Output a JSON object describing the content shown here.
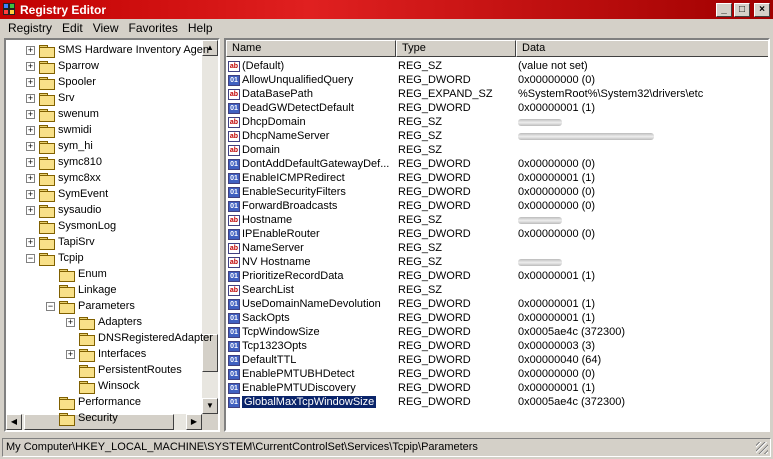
{
  "window": {
    "title": "Registry Editor"
  },
  "menu": [
    "Registry",
    "Edit",
    "View",
    "Favorites",
    "Help"
  ],
  "tree": [
    {
      "label": "SMS Hardware Inventory Agen",
      "exp": "+",
      "level": 1
    },
    {
      "label": "Sparrow",
      "exp": "+",
      "level": 1
    },
    {
      "label": "Spooler",
      "exp": "+",
      "level": 1
    },
    {
      "label": "Srv",
      "exp": "+",
      "level": 1
    },
    {
      "label": "swenum",
      "exp": "+",
      "level": 1
    },
    {
      "label": "swmidi",
      "exp": "+",
      "level": 1
    },
    {
      "label": "sym_hi",
      "exp": "+",
      "level": 1
    },
    {
      "label": "symc810",
      "exp": "+",
      "level": 1
    },
    {
      "label": "symc8xx",
      "exp": "+",
      "level": 1
    },
    {
      "label": "SymEvent",
      "exp": "+",
      "level": 1
    },
    {
      "label": "sysaudio",
      "exp": "+",
      "level": 1
    },
    {
      "label": "SysmonLog",
      "exp": "",
      "level": 1
    },
    {
      "label": "TapiSrv",
      "exp": "+",
      "level": 1
    },
    {
      "label": "Tcpip",
      "exp": "-",
      "level": 1
    },
    {
      "label": "Enum",
      "exp": "",
      "level": 2
    },
    {
      "label": "Linkage",
      "exp": "",
      "level": 2
    },
    {
      "label": "Parameters",
      "exp": "-",
      "level": 2
    },
    {
      "label": "Adapters",
      "exp": "+",
      "level": 3
    },
    {
      "label": "DNSRegisteredAdapter",
      "exp": "",
      "level": 3
    },
    {
      "label": "Interfaces",
      "exp": "+",
      "level": 3
    },
    {
      "label": "PersistentRoutes",
      "exp": "",
      "level": 3
    },
    {
      "label": "Winsock",
      "exp": "",
      "level": 3
    },
    {
      "label": "Performance",
      "exp": "",
      "level": 2
    },
    {
      "label": "Security",
      "exp": "",
      "level": 2
    }
  ],
  "columns": {
    "name": "Name",
    "type": "Type",
    "data": "Data"
  },
  "values": [
    {
      "name": "(Default)",
      "type": "REG_SZ",
      "data": "(value not set)",
      "icon": "sz"
    },
    {
      "name": "AllowUnqualifiedQuery",
      "type": "REG_DWORD",
      "data": "0x00000000 (0)",
      "icon": "dw"
    },
    {
      "name": "DataBasePath",
      "type": "REG_EXPAND_SZ",
      "data": "%SystemRoot%\\System32\\drivers\\etc",
      "icon": "sz"
    },
    {
      "name": "DeadGWDetectDefault",
      "type": "REG_DWORD",
      "data": "0x00000001 (1)",
      "icon": "dw"
    },
    {
      "name": "DhcpDomain",
      "type": "REG_SZ",
      "data": "",
      "icon": "sz",
      "redacted": "short"
    },
    {
      "name": "DhcpNameServer",
      "type": "REG_SZ",
      "data": "",
      "icon": "sz",
      "redacted": "long"
    },
    {
      "name": "Domain",
      "type": "REG_SZ",
      "data": "",
      "icon": "sz"
    },
    {
      "name": "DontAddDefaultGatewayDef...",
      "type": "REG_DWORD",
      "data": "0x00000000 (0)",
      "icon": "dw"
    },
    {
      "name": "EnableICMPRedirect",
      "type": "REG_DWORD",
      "data": "0x00000001 (1)",
      "icon": "dw"
    },
    {
      "name": "EnableSecurityFilters",
      "type": "REG_DWORD",
      "data": "0x00000000 (0)",
      "icon": "dw"
    },
    {
      "name": "ForwardBroadcasts",
      "type": "REG_DWORD",
      "data": "0x00000000 (0)",
      "icon": "dw"
    },
    {
      "name": "Hostname",
      "type": "REG_SZ",
      "data": "",
      "icon": "sz",
      "redacted": "short"
    },
    {
      "name": "IPEnableRouter",
      "type": "REG_DWORD",
      "data": "0x00000000 (0)",
      "icon": "dw"
    },
    {
      "name": "NameServer",
      "type": "REG_SZ",
      "data": "",
      "icon": "sz"
    },
    {
      "name": "NV Hostname",
      "type": "REG_SZ",
      "data": "",
      "icon": "sz",
      "redacted": "short"
    },
    {
      "name": "PrioritizeRecordData",
      "type": "REG_DWORD",
      "data": "0x00000001 (1)",
      "icon": "dw"
    },
    {
      "name": "SearchList",
      "type": "REG_SZ",
      "data": "",
      "icon": "sz"
    },
    {
      "name": "UseDomainNameDevolution",
      "type": "REG_DWORD",
      "data": "0x00000001 (1)",
      "icon": "dw"
    },
    {
      "name": "SackOpts",
      "type": "REG_DWORD",
      "data": "0x00000001 (1)",
      "icon": "dw"
    },
    {
      "name": "TcpWindowSize",
      "type": "REG_DWORD",
      "data": "0x0005ae4c (372300)",
      "icon": "dw"
    },
    {
      "name": "Tcp1323Opts",
      "type": "REG_DWORD",
      "data": "0x00000003 (3)",
      "icon": "dw"
    },
    {
      "name": "DefaultTTL",
      "type": "REG_DWORD",
      "data": "0x00000040 (64)",
      "icon": "dw"
    },
    {
      "name": "EnablePMTUBHDetect",
      "type": "REG_DWORD",
      "data": "0x00000000 (0)",
      "icon": "dw"
    },
    {
      "name": "EnablePMTUDiscovery",
      "type": "REG_DWORD",
      "data": "0x00000001 (1)",
      "icon": "dw"
    },
    {
      "name": "GlobalMaxTcpWindowSize",
      "type": "REG_DWORD",
      "data": "0x0005ae4c (372300)",
      "icon": "dw",
      "selected": true
    }
  ],
  "status": {
    "path": "My Computer\\HKEY_LOCAL_MACHINE\\SYSTEM\\CurrentControlSet\\Services\\Tcpip\\Parameters"
  },
  "colors": {
    "title_bar": "#c00000",
    "selection": "#0a246a",
    "window_bg": "#d4d0c8"
  }
}
